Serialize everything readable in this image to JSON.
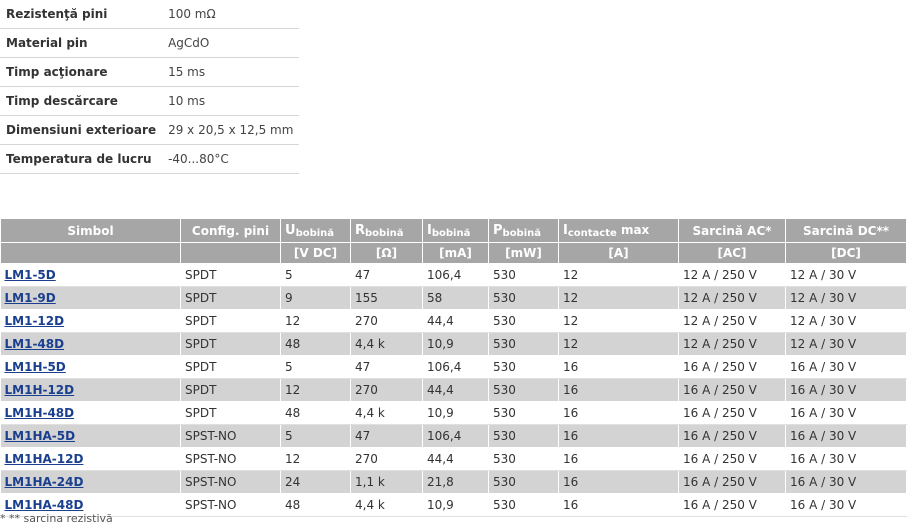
{
  "specs": [
    {
      "label": "Rezistenţă pini",
      "value": "100 mΩ"
    },
    {
      "label": "Material pin",
      "value": "AgCdO"
    },
    {
      "label": "Timp acţionare",
      "value": "15 ms"
    },
    {
      "label": "Timp descărcare",
      "value": "10 ms"
    },
    {
      "label": "Dimensiuni exterioare",
      "value": "29 x 20,5 x 12,5 mm"
    },
    {
      "label": "Temperatura de lucru",
      "value": "-40...80°C"
    }
  ],
  "table": {
    "headers": {
      "simbol": "Simbol",
      "config": "Config. pini",
      "u_main": "U",
      "u_sub": "bobină",
      "u_unit": "[V DC]",
      "r_main": "R",
      "r_sub": "bobină",
      "r_unit": "[Ω]",
      "i_main": "I",
      "i_sub": "bobină",
      "i_unit": "[mA]",
      "p_main": "P",
      "p_sub": "bobină",
      "p_unit": "[mW]",
      "ic_main": "I",
      "ic_sub": "contacte",
      "ic_suffix": " max",
      "ic_unit": "[A]",
      "ac": "Sarcină AC*",
      "ac_unit": "[AC]",
      "dc": "Sarcină DC**",
      "dc_unit": "[DC]"
    },
    "rows": [
      [
        "LM1-5D",
        "SPDT",
        "5",
        "47",
        "106,4",
        "530",
        "12",
        "12 A / 250 V",
        "12 A / 30 V"
      ],
      [
        "LM1-9D",
        "SPDT",
        "9",
        "155",
        "58",
        "530",
        "12",
        "12 A / 250 V",
        "12 A / 30 V"
      ],
      [
        "LM1-12D",
        "SPDT",
        "12",
        "270",
        "44,4",
        "530",
        "12",
        "12 A / 250 V",
        "12 A / 30 V"
      ],
      [
        "LM1-48D",
        "SPDT",
        "48",
        "4,4 k",
        "10,9",
        "530",
        "12",
        "12 A / 250 V",
        "12 A / 30 V"
      ],
      [
        "LM1H-5D",
        "SPDT",
        "5",
        "47",
        "106,4",
        "530",
        "16",
        "16 A / 250 V",
        "16 A / 30 V"
      ],
      [
        "LM1H-12D",
        "SPDT",
        "12",
        "270",
        "44,4",
        "530",
        "16",
        "16 A / 250 V",
        "16 A / 30 V"
      ],
      [
        "LM1H-48D",
        "SPDT",
        "48",
        "4,4 k",
        "10,9",
        "530",
        "16",
        "16 A / 250 V",
        "16 A / 30 V"
      ],
      [
        "LM1HA-5D",
        "SPST-NO",
        "5",
        "47",
        "106,4",
        "530",
        "16",
        "16 A / 250 V",
        "16 A / 30 V"
      ],
      [
        "LM1HA-12D",
        "SPST-NO",
        "12",
        "270",
        "44,4",
        "530",
        "16",
        "16 A / 250 V",
        "16 A / 30 V"
      ],
      [
        "LM1HA-24D",
        "SPST-NO",
        "24",
        "1,1 k",
        "21,8",
        "530",
        "16",
        "16 A / 250 V",
        "16 A / 30 V"
      ],
      [
        "LM1HA-48D",
        "SPST-NO",
        "48",
        "4,4 k",
        "10,9",
        "530",
        "16",
        "16 A / 250 V",
        "16 A / 30 V"
      ]
    ]
  },
  "footnote": "* ** sarcina rezistivă"
}
